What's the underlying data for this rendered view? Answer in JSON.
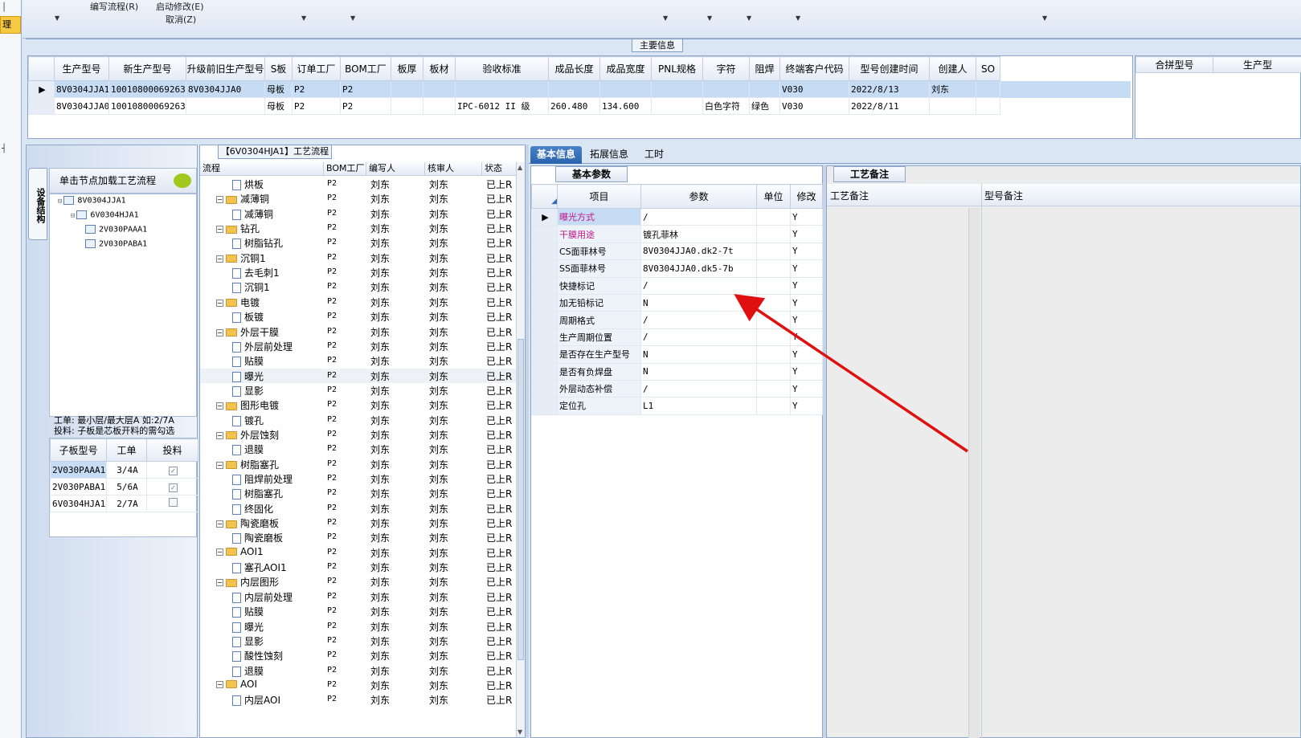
{
  "toolbar": {
    "edit_flow": "编写流程(R)",
    "start_modify": "启动修改(E)",
    "cancel": "取消(Z)"
  },
  "left_strip": {
    "marker": "理"
  },
  "main_info": {
    "title": "主要信息",
    "columns": [
      "生产型号",
      "新生产型号",
      "升级前旧生产型号",
      "S板",
      "订单工厂",
      "BOM工厂",
      "板厚",
      "板材",
      "验收标准",
      "成品长度",
      "成品宽度",
      "PNL规格",
      "字符",
      "阻焊",
      "终端客户代码",
      "型号创建时间",
      "创建人",
      "SO"
    ],
    "rows": [
      [
        "8V0304JJA1",
        "10010800069263",
        "8V0304JJA0",
        "母板",
        "P2",
        "P2",
        "",
        "",
        "",
        "",
        "",
        "",
        "",
        "",
        "V030",
        "2022/8/13",
        "刘东",
        ""
      ],
      [
        "8V0304JJA0",
        "10010800069263",
        "",
        "母板",
        "P2",
        "P2",
        "",
        "",
        "IPC-6012 II 级",
        "260.480",
        "134.600",
        "",
        "白色字符",
        "绿色",
        "V030",
        "2022/8/11",
        "",
        ""
      ]
    ],
    "side_columns": [
      "合拼型号",
      "生产型"
    ]
  },
  "structure": {
    "tab_label": "设备结构",
    "header": "单击节点加载工艺流程",
    "tree": [
      {
        "label": "8V0304JJA1",
        "level": 0
      },
      {
        "label": "6V0304HJA1",
        "level": 1
      },
      {
        "label": "2V030PAAA1",
        "level": 2
      },
      {
        "label": "2V030PABA1",
        "level": 2
      }
    ],
    "note_line1": "工单: 最小层/最大层A 如:2/7A",
    "note_line2": "投料: 子板是芯板开料的需勾选",
    "sub_columns": [
      "子板型号",
      "工单",
      "投料"
    ],
    "sub_rows": [
      {
        "model": "2V030PAAA1",
        "order": "3/4A",
        "checked": true
      },
      {
        "model": "2V030PABA1",
        "order": "5/6A",
        "checked": true
      },
      {
        "model": "6V0304HJA1",
        "order": "2/7A",
        "checked": false
      }
    ]
  },
  "flow": {
    "title": "【6V0304HJA1】工艺流程",
    "columns": [
      "流程",
      "BOM工厂",
      "编写人",
      "核审人",
      "状态"
    ],
    "rows": [
      {
        "name": "烘板",
        "type": "doc",
        "level": 1
      },
      {
        "name": "减薄铜",
        "type": "folder",
        "level": 0
      },
      {
        "name": "减薄铜",
        "type": "doc",
        "level": 1
      },
      {
        "name": "钻孔",
        "type": "folder",
        "level": 0
      },
      {
        "name": "树脂钻孔",
        "type": "doc",
        "level": 1
      },
      {
        "name": "沉铜1",
        "type": "folder",
        "level": 0
      },
      {
        "name": "去毛刺1",
        "type": "doc",
        "level": 1
      },
      {
        "name": "沉铜1",
        "type": "doc",
        "level": 1
      },
      {
        "name": "电镀",
        "type": "folder",
        "level": 0
      },
      {
        "name": "板镀",
        "type": "doc",
        "level": 1
      },
      {
        "name": "外层干膜",
        "type": "folder",
        "level": 0
      },
      {
        "name": "外层前处理",
        "type": "doc",
        "level": 1
      },
      {
        "name": "贴膜",
        "type": "doc",
        "level": 1
      },
      {
        "name": "曝光",
        "type": "doc",
        "level": 1
      },
      {
        "name": "显影",
        "type": "doc",
        "level": 1
      },
      {
        "name": "图形电镀",
        "type": "folder",
        "level": 0
      },
      {
        "name": "镀孔",
        "type": "doc",
        "level": 1
      },
      {
        "name": "外层蚀刻",
        "type": "folder",
        "level": 0
      },
      {
        "name": "退膜",
        "type": "doc",
        "level": 1
      },
      {
        "name": "树脂塞孔",
        "type": "folder",
        "level": 0
      },
      {
        "name": "阻焊前处理",
        "type": "doc",
        "level": 1
      },
      {
        "name": "树脂塞孔",
        "type": "doc",
        "level": 1
      },
      {
        "name": "终固化",
        "type": "doc",
        "level": 1
      },
      {
        "name": "陶瓷磨板",
        "type": "folder",
        "level": 0
      },
      {
        "name": "陶瓷磨板",
        "type": "doc",
        "level": 1
      },
      {
        "name": "AOI1",
        "type": "folder",
        "level": 0
      },
      {
        "name": "塞孔AOI1",
        "type": "doc",
        "level": 1
      },
      {
        "name": "内层图形",
        "type": "folder",
        "level": 0
      },
      {
        "name": "内层前处理",
        "type": "doc",
        "level": 1
      },
      {
        "name": "贴膜",
        "type": "doc",
        "level": 1
      },
      {
        "name": "曝光",
        "type": "doc",
        "level": 1
      },
      {
        "name": "显影",
        "type": "doc",
        "level": 1
      },
      {
        "name": "酸性蚀刻",
        "type": "doc",
        "level": 1
      },
      {
        "name": "退膜",
        "type": "doc",
        "level": 1
      },
      {
        "name": "AOI",
        "type": "folder",
        "level": 0
      },
      {
        "name": "内层AOI",
        "type": "doc",
        "level": 1
      }
    ],
    "bom": "P2",
    "writer": "刘东",
    "reviewer": "刘东",
    "status": "已上R"
  },
  "right_tabs": [
    "基本信息",
    "拓展信息",
    "工时"
  ],
  "params": {
    "tab": "基本参数",
    "columns": [
      "项目",
      "参数",
      "单位",
      "修改"
    ],
    "rows": [
      {
        "name": "曝光方式",
        "value": "/",
        "unit": "",
        "mod": "Y",
        "pink": true
      },
      {
        "name": "干膜用途",
        "value": "镀孔菲林",
        "unit": "",
        "mod": "Y",
        "pink": true
      },
      {
        "name": "CS面菲林号",
        "value": "8V0304JJA0.dk2-7t",
        "unit": "",
        "mod": "Y",
        "pink": false
      },
      {
        "name": "SS面菲林号",
        "value": "8V0304JJA0.dk5-7b",
        "unit": "",
        "mod": "Y",
        "pink": false
      },
      {
        "name": "快捷标记",
        "value": "/",
        "unit": "",
        "mod": "Y",
        "pink": false
      },
      {
        "name": "加无铅标记",
        "value": "N",
        "unit": "",
        "mod": "Y",
        "pink": false
      },
      {
        "name": "周期格式",
        "value": "/",
        "unit": "",
        "mod": "Y",
        "pink": false
      },
      {
        "name": "生产周期位置",
        "value": "/",
        "unit": "",
        "mod": "Y",
        "pink": false
      },
      {
        "name": "是否存在生产型号",
        "value": "N",
        "unit": "",
        "mod": "Y",
        "pink": false
      },
      {
        "name": "是否有负焊盘",
        "value": "N",
        "unit": "",
        "mod": "Y",
        "pink": false
      },
      {
        "name": "外层动态补偿",
        "value": "/",
        "unit": "",
        "mod": "Y",
        "pink": false
      },
      {
        "name": "定位孔",
        "value": "L1",
        "unit": "",
        "mod": "Y",
        "pink": false
      }
    ]
  },
  "craft": {
    "tab": "工艺备注",
    "col1": "工艺备注",
    "col2": "型号备注"
  },
  "colors": {
    "accent": "#2a63ad",
    "annotation_arrow": "#e01010",
    "pink_label": "#c0168a"
  }
}
